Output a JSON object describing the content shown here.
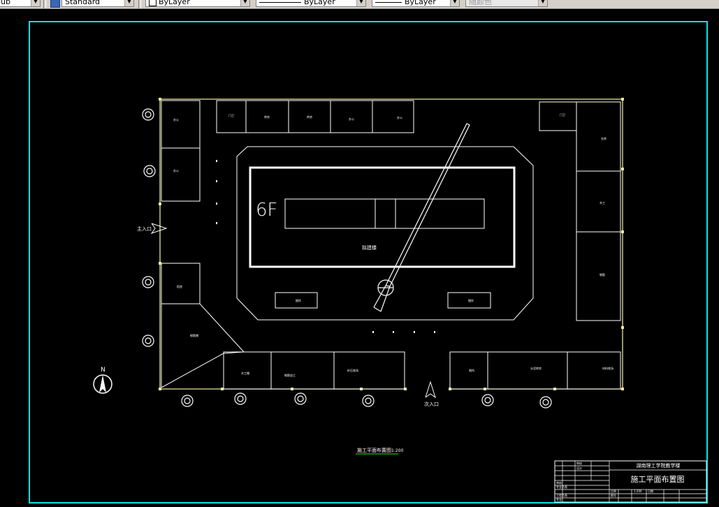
{
  "toolbar": {
    "textstyle_value": "ub",
    "dimstyle_value": "Standard",
    "layer_color_value": "ByLayer",
    "linetype_value": "ByLayer",
    "lineweight_value": "ByLayer",
    "plotstyle_value": "随颜色"
  },
  "drawing": {
    "label_6f": "6F",
    "label_building": "拟建楼",
    "label_main_entrance": "主入口",
    "label_second_entrance": "次入口",
    "label_north": "N",
    "plan_caption": "施工平面布置图",
    "plan_scale": "1:200",
    "rooms": {
      "top_1": "门卫",
      "top_2": "库房",
      "top_3": "库房",
      "top_4": "办公",
      "top_5": "办公",
      "left_1": "办公",
      "left_2": "办公",
      "left_3": "宿舍",
      "left_4": "钢筋棚",
      "right_1": "门卫",
      "right_2": "仓库",
      "right_3": "木工",
      "right_4": "钢筋",
      "bottom_1": "木工棚",
      "bottom_2": "钢筋加工",
      "bottom_3": "砂石堆场",
      "bottom_4": "厕所",
      "bottom_5": "水泥库房",
      "bottom_6": "材料堆场",
      "pad_left": "搅拌",
      "pad_right": "搅拌"
    }
  },
  "titleblock": {
    "school": "湖南理工学院教学楼",
    "title": "施工平面布置图",
    "scale_value": "1:200",
    "row_labels": [
      "审核",
      "设计",
      "校对",
      "描图",
      "审核",
      "专业负责",
      "工程负责",
      "专业"
    ],
    "small_labels": [
      "比例",
      "图号",
      "日期"
    ]
  },
  "colors": {
    "background": "#000000",
    "frame": "#00e5e5",
    "site_boundary": "#e8e8a0",
    "linework": "#ffffff",
    "caption": "#ffffff",
    "caption_underline": "#00ff00"
  }
}
